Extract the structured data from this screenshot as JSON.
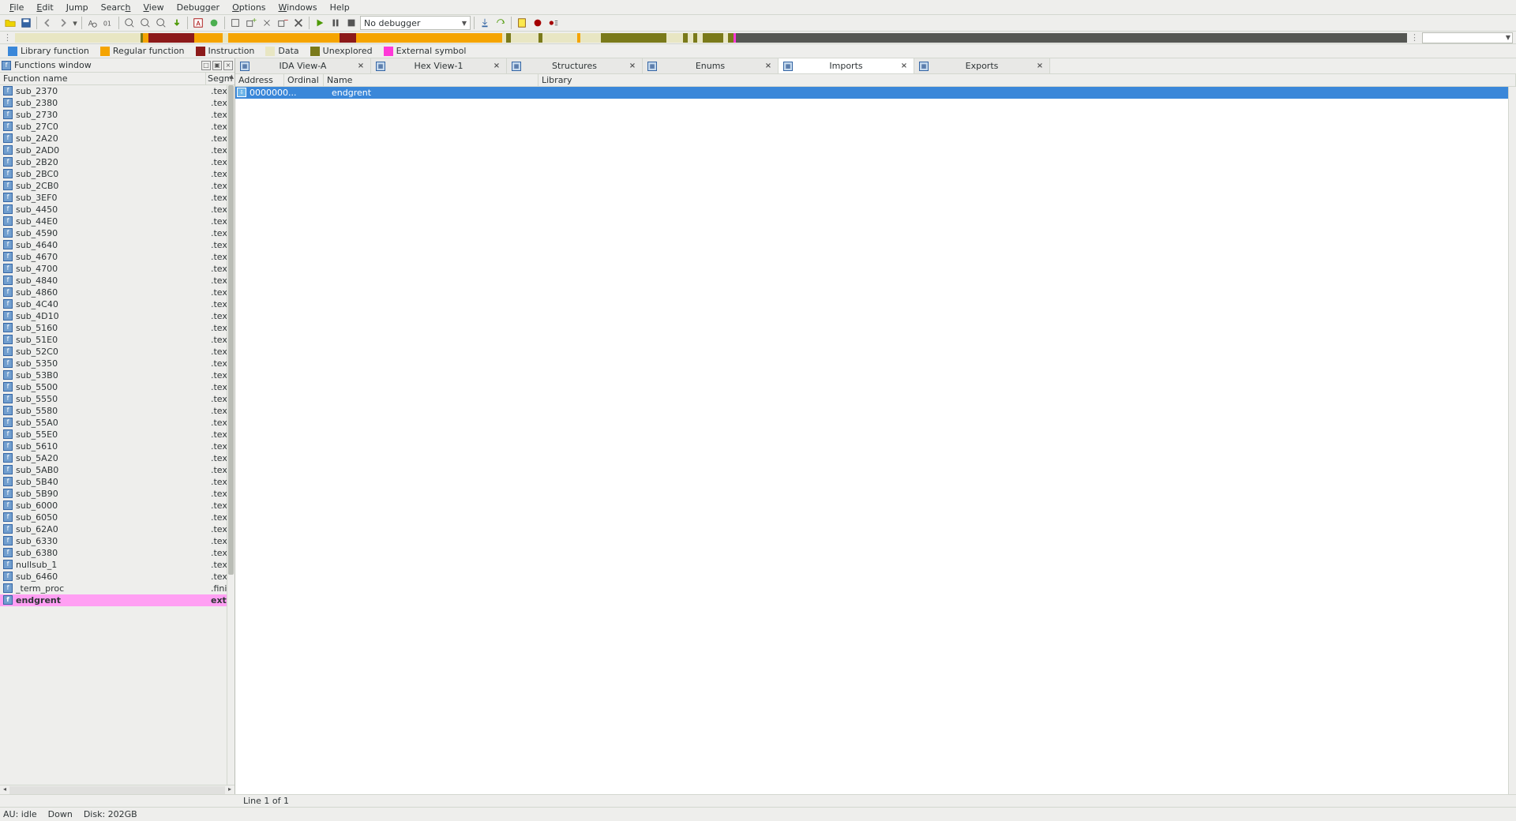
{
  "menu": [
    "File",
    "Edit",
    "Jump",
    "Search",
    "View",
    "Debugger",
    "Options",
    "Windows",
    "Help"
  ],
  "debugger_selector": "No debugger",
  "legend": [
    {
      "label": "Library function",
      "color": "#3a87d9"
    },
    {
      "label": "Regular function",
      "color": "#f5a400"
    },
    {
      "label": "Instruction",
      "color": "#8c1a1a"
    },
    {
      "label": "Data",
      "color": "#e8e6c3"
    },
    {
      "label": "Unexplored",
      "color": "#7a7a1a"
    },
    {
      "label": "External symbol",
      "color": "#ff38d8"
    }
  ],
  "nav_segments": [
    {
      "l": 0.0,
      "w": 0.09,
      "c": "#e8e6c3"
    },
    {
      "l": 0.09,
      "w": 0.002,
      "c": "#7a7a1a"
    },
    {
      "l": 0.092,
      "w": 0.004,
      "c": "#f5a400"
    },
    {
      "l": 0.096,
      "w": 0.003,
      "c": "#8c1a1a"
    },
    {
      "l": 0.099,
      "w": 0.03,
      "c": "#8c1a1a"
    },
    {
      "l": 0.129,
      "w": 0.02,
      "c": "#f5a400"
    },
    {
      "l": 0.149,
      "w": 0.004,
      "c": "#e8e6c3"
    },
    {
      "l": 0.153,
      "w": 0.08,
      "c": "#f5a400"
    },
    {
      "l": 0.233,
      "w": 0.012,
      "c": "#8c1a1a"
    },
    {
      "l": 0.245,
      "w": 0.015,
      "c": "#f5a400"
    },
    {
      "l": 0.26,
      "w": 0.09,
      "c": "#f5a400"
    },
    {
      "l": 0.35,
      "w": 0.003,
      "c": "#e8e6c3"
    },
    {
      "l": 0.353,
      "w": 0.003,
      "c": "#7a7a1a"
    },
    {
      "l": 0.356,
      "w": 0.02,
      "c": "#e8e6c3"
    },
    {
      "l": 0.376,
      "w": 0.003,
      "c": "#7a7a1a"
    },
    {
      "l": 0.379,
      "w": 0.025,
      "c": "#e8e6c3"
    },
    {
      "l": 0.404,
      "w": 0.002,
      "c": "#f5a400"
    },
    {
      "l": 0.406,
      "w": 0.015,
      "c": "#e8e6c3"
    },
    {
      "l": 0.421,
      "w": 0.002,
      "c": "#7a7a1a"
    },
    {
      "l": 0.423,
      "w": 0.045,
      "c": "#7a7a1a"
    },
    {
      "l": 0.468,
      "w": 0.012,
      "c": "#e8e6c3"
    },
    {
      "l": 0.48,
      "w": 0.003,
      "c": "#7a7a1a"
    },
    {
      "l": 0.483,
      "w": 0.004,
      "c": "#e8e6c3"
    },
    {
      "l": 0.487,
      "w": 0.003,
      "c": "#7a7a1a"
    },
    {
      "l": 0.49,
      "w": 0.004,
      "c": "#e8e6c3"
    },
    {
      "l": 0.494,
      "w": 0.015,
      "c": "#7a7a1a"
    },
    {
      "l": 0.509,
      "w": 0.003,
      "c": "#e8e6c3"
    },
    {
      "l": 0.512,
      "w": 0.004,
      "c": "#7a7a1a"
    },
    {
      "l": 0.516,
      "w": 0.002,
      "c": "#ff38d8"
    },
    {
      "l": 0.518,
      "w": 0.205,
      "c": "#555753"
    }
  ],
  "functions_window": {
    "title": "Functions window",
    "columns": [
      "Function name",
      "Segm"
    ],
    "items": [
      {
        "name": "sub_2370",
        "seg": ".text"
      },
      {
        "name": "sub_2380",
        "seg": ".text"
      },
      {
        "name": "sub_2730",
        "seg": ".text"
      },
      {
        "name": "sub_27C0",
        "seg": ".text"
      },
      {
        "name": "sub_2A20",
        "seg": ".text"
      },
      {
        "name": "sub_2AD0",
        "seg": ".text"
      },
      {
        "name": "sub_2B20",
        "seg": ".text"
      },
      {
        "name": "sub_2BC0",
        "seg": ".text"
      },
      {
        "name": "sub_2CB0",
        "seg": ".text"
      },
      {
        "name": "sub_3EF0",
        "seg": ".text"
      },
      {
        "name": "sub_4450",
        "seg": ".text"
      },
      {
        "name": "sub_44E0",
        "seg": ".text"
      },
      {
        "name": "sub_4590",
        "seg": ".text"
      },
      {
        "name": "sub_4640",
        "seg": ".text"
      },
      {
        "name": "sub_4670",
        "seg": ".text"
      },
      {
        "name": "sub_4700",
        "seg": ".text"
      },
      {
        "name": "sub_4840",
        "seg": ".text"
      },
      {
        "name": "sub_4860",
        "seg": ".text"
      },
      {
        "name": "sub_4C40",
        "seg": ".text"
      },
      {
        "name": "sub_4D10",
        "seg": ".text"
      },
      {
        "name": "sub_5160",
        "seg": ".text"
      },
      {
        "name": "sub_51E0",
        "seg": ".text"
      },
      {
        "name": "sub_52C0",
        "seg": ".text"
      },
      {
        "name": "sub_5350",
        "seg": ".text"
      },
      {
        "name": "sub_53B0",
        "seg": ".text"
      },
      {
        "name": "sub_5500",
        "seg": ".text"
      },
      {
        "name": "sub_5550",
        "seg": ".text"
      },
      {
        "name": "sub_5580",
        "seg": ".text"
      },
      {
        "name": "sub_55A0",
        "seg": ".text"
      },
      {
        "name": "sub_55E0",
        "seg": ".text"
      },
      {
        "name": "sub_5610",
        "seg": ".text"
      },
      {
        "name": "sub_5A20",
        "seg": ".text"
      },
      {
        "name": "sub_5AB0",
        "seg": ".text"
      },
      {
        "name": "sub_5B40",
        "seg": ".text"
      },
      {
        "name": "sub_5B90",
        "seg": ".text"
      },
      {
        "name": "sub_6000",
        "seg": ".text"
      },
      {
        "name": "sub_6050",
        "seg": ".text"
      },
      {
        "name": "sub_62A0",
        "seg": ".text"
      },
      {
        "name": "sub_6330",
        "seg": ".text"
      },
      {
        "name": "sub_6380",
        "seg": ".text"
      },
      {
        "name": "nullsub_1",
        "seg": ".text"
      },
      {
        "name": "sub_6460",
        "seg": ".text"
      },
      {
        "name": "_term_proc",
        "seg": ".fini"
      },
      {
        "name": "endgrent",
        "seg": "exte",
        "sel": true
      }
    ]
  },
  "tabs": [
    {
      "label": "IDA View-A",
      "active": false
    },
    {
      "label": "Hex View-1",
      "active": false
    },
    {
      "label": "Structures",
      "active": false
    },
    {
      "label": "Enums",
      "active": false
    },
    {
      "label": "Imports",
      "active": true
    },
    {
      "label": "Exports",
      "active": false
    }
  ],
  "imports": {
    "columns": [
      "Address",
      "Ordinal",
      "Name",
      "Library"
    ],
    "rows": [
      {
        "address": "0000000...",
        "ordinal": "",
        "name": "endgrent",
        "library": ""
      }
    ]
  },
  "lineinfo": "Line 1 of 1",
  "status": {
    "au": "AU:  idle",
    "down": "Down",
    "disk": "Disk: 202GB"
  }
}
